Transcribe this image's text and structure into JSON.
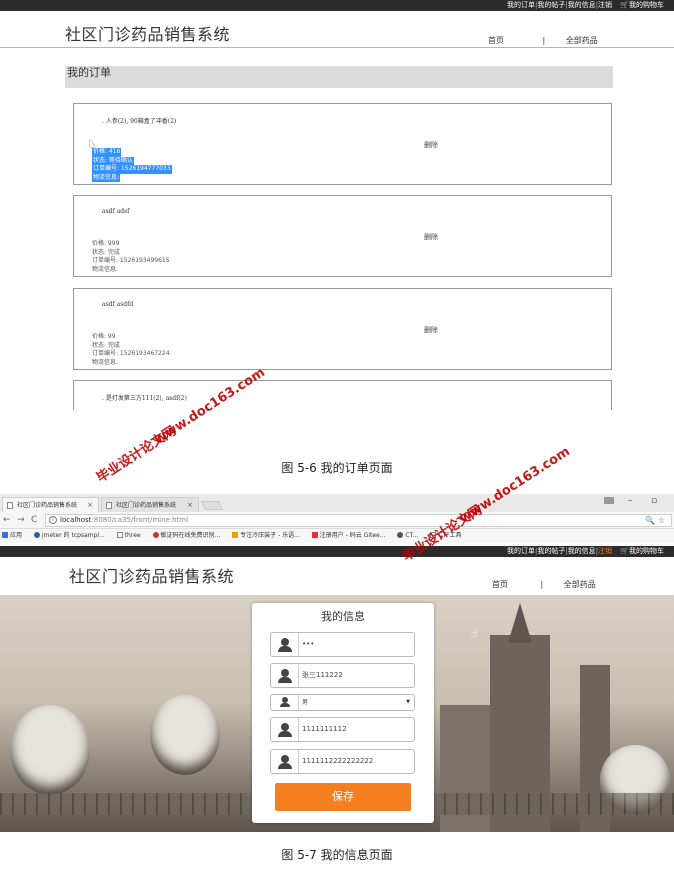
{
  "topbar": {
    "my_orders": "我的订单",
    "my_posts": "我的帖子",
    "my_info": "我的信息",
    "logout": "注销",
    "cart": "我的购物车"
  },
  "site": {
    "brand": "社区门诊药品销售系统",
    "nav_home": "首页",
    "nav_divider": "|",
    "nav_all_drugs": "全部药品"
  },
  "orders_page": {
    "title": "我的订单",
    "delete_label": "删除",
    "orders": [
      {
        "name": ". 人参(2), 90箱盒了冲香(2)",
        "price": "价格: 416",
        "status": "状态: 等待确认",
        "order_no": "订单编号: 1526194777033",
        "logistics": "物流信息:"
      },
      {
        "name": "asdf adsf",
        "price": "价格: 999",
        "status": "状态: 完成",
        "order_no": "订单编号: 1526193499615",
        "logistics": "物流信息:"
      },
      {
        "name": "asdf asdfd",
        "price": "价格: 99",
        "status": "状态: 完成",
        "order_no": "订单编号: 1526193467224",
        "logistics": "物流信息:"
      },
      {
        "name": ". 是打发第三方111(2), asdf(2)",
        "price": "",
        "status": "",
        "order_no": "",
        "logistics": ""
      }
    ]
  },
  "caption1": "图 5-6 我的订单页面",
  "browser": {
    "tab1": "社区门诊药品销售系统",
    "tab2": "社区门诊药品销售系统",
    "url_host": "localhost",
    "url_path": ":8080/ca35/front/mine.html",
    "bookmarks": [
      "应用",
      "jmeter 的 tcpsampl...",
      "three",
      "敏证码在线免费识别...",
      "专注冷压装子 - 乐语...",
      "注册用户 - 码云 Gitee...",
      "CT...",
      "CTF工具"
    ]
  },
  "info_page": {
    "title": "我的信息",
    "username": "•••",
    "name": "张三111222",
    "gender": "男",
    "phone": "1111111112",
    "id_number": "1111112222222222",
    "save": "保存"
  },
  "caption2": "图 5-7 我的信息页面",
  "watermarks": [
    "毕业设计论文网",
    "www.doc163.com"
  ],
  "colors": {
    "accent_orange": "#f57f1f",
    "topbar_bg": "#2b2b2b",
    "selection_blue": "#3390ff",
    "watermark_red": "#c00000"
  }
}
